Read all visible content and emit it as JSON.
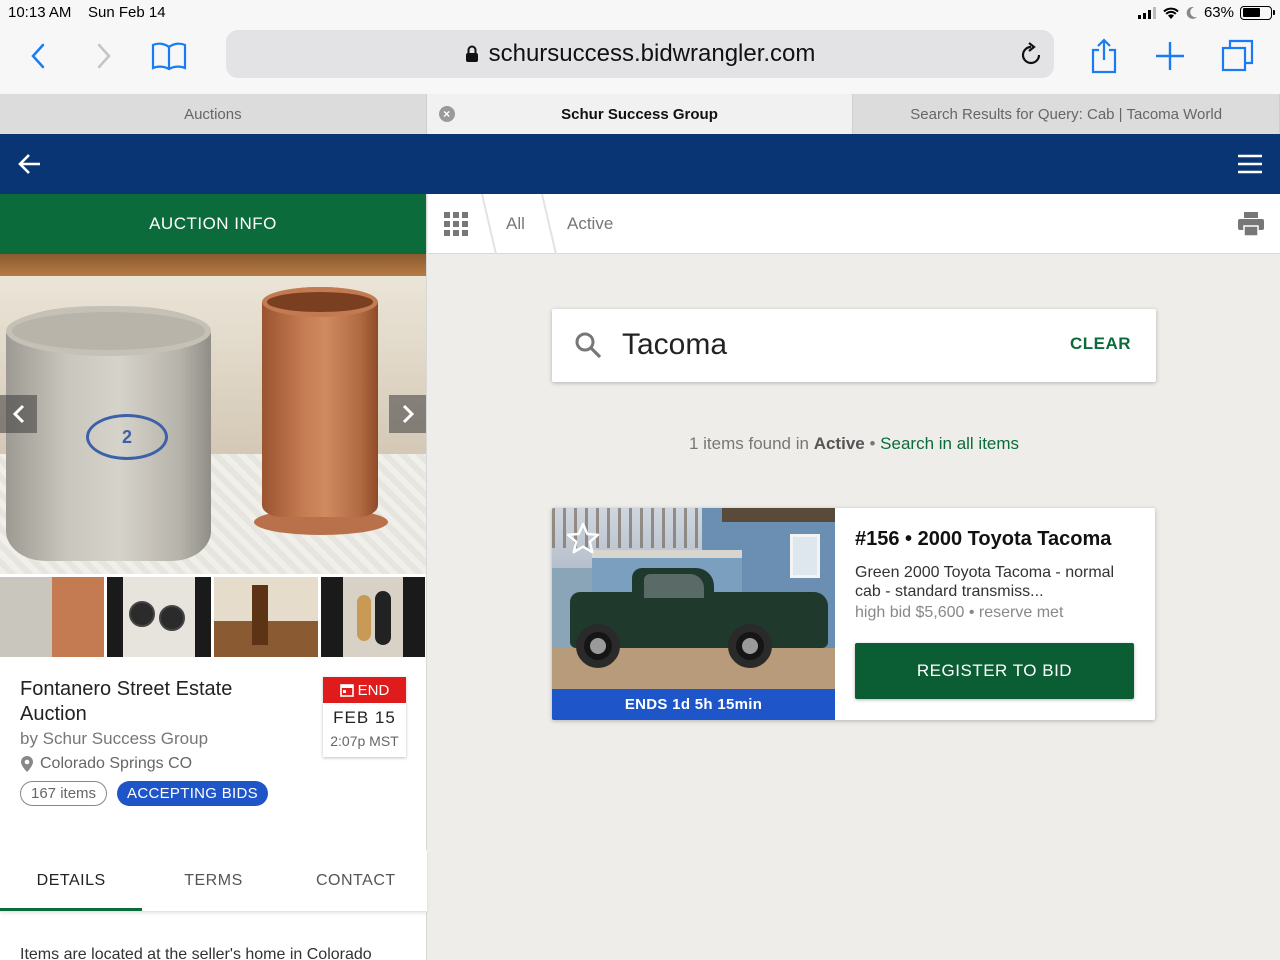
{
  "status_bar": {
    "time": "10:13 AM",
    "date": "Sun Feb 14",
    "battery": "63%",
    "battery_level": 0.63
  },
  "browser": {
    "url": "schursuccess.bidwrangler.com",
    "icons": [
      "back-icon",
      "forward-icon",
      "bookmarks-icon",
      "lock-icon",
      "reload-icon",
      "share-icon",
      "new-tab-icon",
      "tabs-icon"
    ],
    "tabs": [
      {
        "label": "Auctions"
      },
      {
        "label": "Schur Success Group"
      },
      {
        "label": "Search Results for Query: Cab | Tacoma World"
      }
    ]
  },
  "app_header": {
    "colors": {
      "navy": "#0a3575",
      "green": "#0b6b3a",
      "blue": "#1e56c9",
      "red": "#e01b1b"
    }
  },
  "left_panel": {
    "section_label": "AUCTION INFO",
    "auction": {
      "title": "Fontanero Street Estate Auction",
      "by": "by Schur Success Group",
      "location": "Colorado Springs CO",
      "items_badge": "167 items",
      "status_badge": "ACCEPTING BIDS",
      "end_label": "END",
      "end_date": "FEB 15",
      "end_time": "2:07p MST"
    },
    "tabs": [
      "DETAILS",
      "TERMS",
      "CONTACT"
    ],
    "details_text": "Items are located at the seller's home in Colorado"
  },
  "filter_bar": {
    "crumbs": [
      "All",
      "Active"
    ]
  },
  "search": {
    "value": "Tacoma",
    "clear_label": "CLEAR"
  },
  "results": {
    "count_text": "1 items found in",
    "scope": "Active",
    "separator": "•",
    "search_all_link": "Search in all items"
  },
  "lot": {
    "title": "#156 • 2000 Toyota Tacoma",
    "description": "Green 2000 Toyota Tacoma - normal cab - standard transmiss...",
    "bid_info": "high bid $5,600 • reserve met",
    "ends": "ENDS 1d 5h 15min",
    "button_label": "REGISTER TO BID"
  }
}
